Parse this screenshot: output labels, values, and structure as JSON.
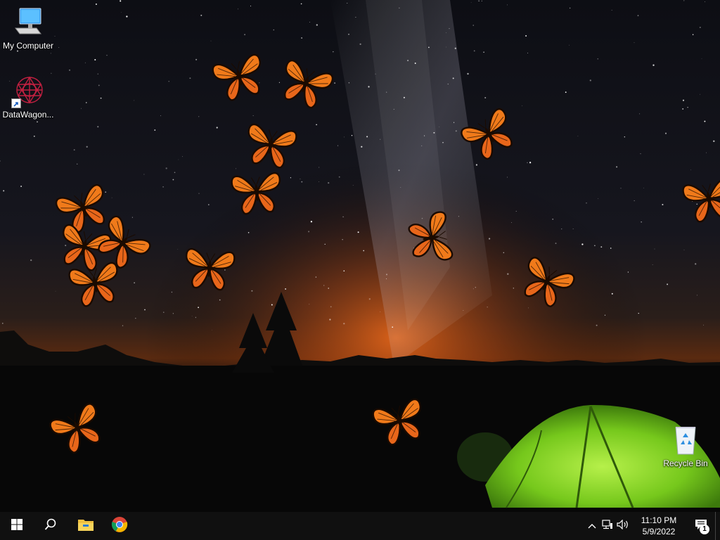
{
  "desktop": {
    "icons": [
      {
        "label": "My Computer",
        "icon": "computer-icon"
      },
      {
        "label": "DataWagon...",
        "icon": "datawagon-icon"
      },
      {
        "label": "Recycle Bin",
        "icon": "recycle-bin-icon"
      }
    ]
  },
  "wallpaper": {
    "description_icon": "night-sky-camping-wallpaper",
    "colors": {
      "sky_top": "#0b0c12",
      "glow": "#e0641a",
      "tent": "#7fd62a"
    }
  },
  "taskbar": {
    "start": "windows-start-icon",
    "search": "search-icon",
    "pinned": [
      {
        "name": "File Explorer",
        "icon": "folder-icon"
      },
      {
        "name": "Google Chrome",
        "icon": "chrome-icon"
      }
    ],
    "tray": {
      "chevron": "chevron-up-icon",
      "network": "network-icon",
      "volume": "volume-icon",
      "time": "11:10 PM",
      "date": "5/9/2022",
      "notifications_icon": "action-center-icon",
      "notifications_count": "1"
    }
  }
}
